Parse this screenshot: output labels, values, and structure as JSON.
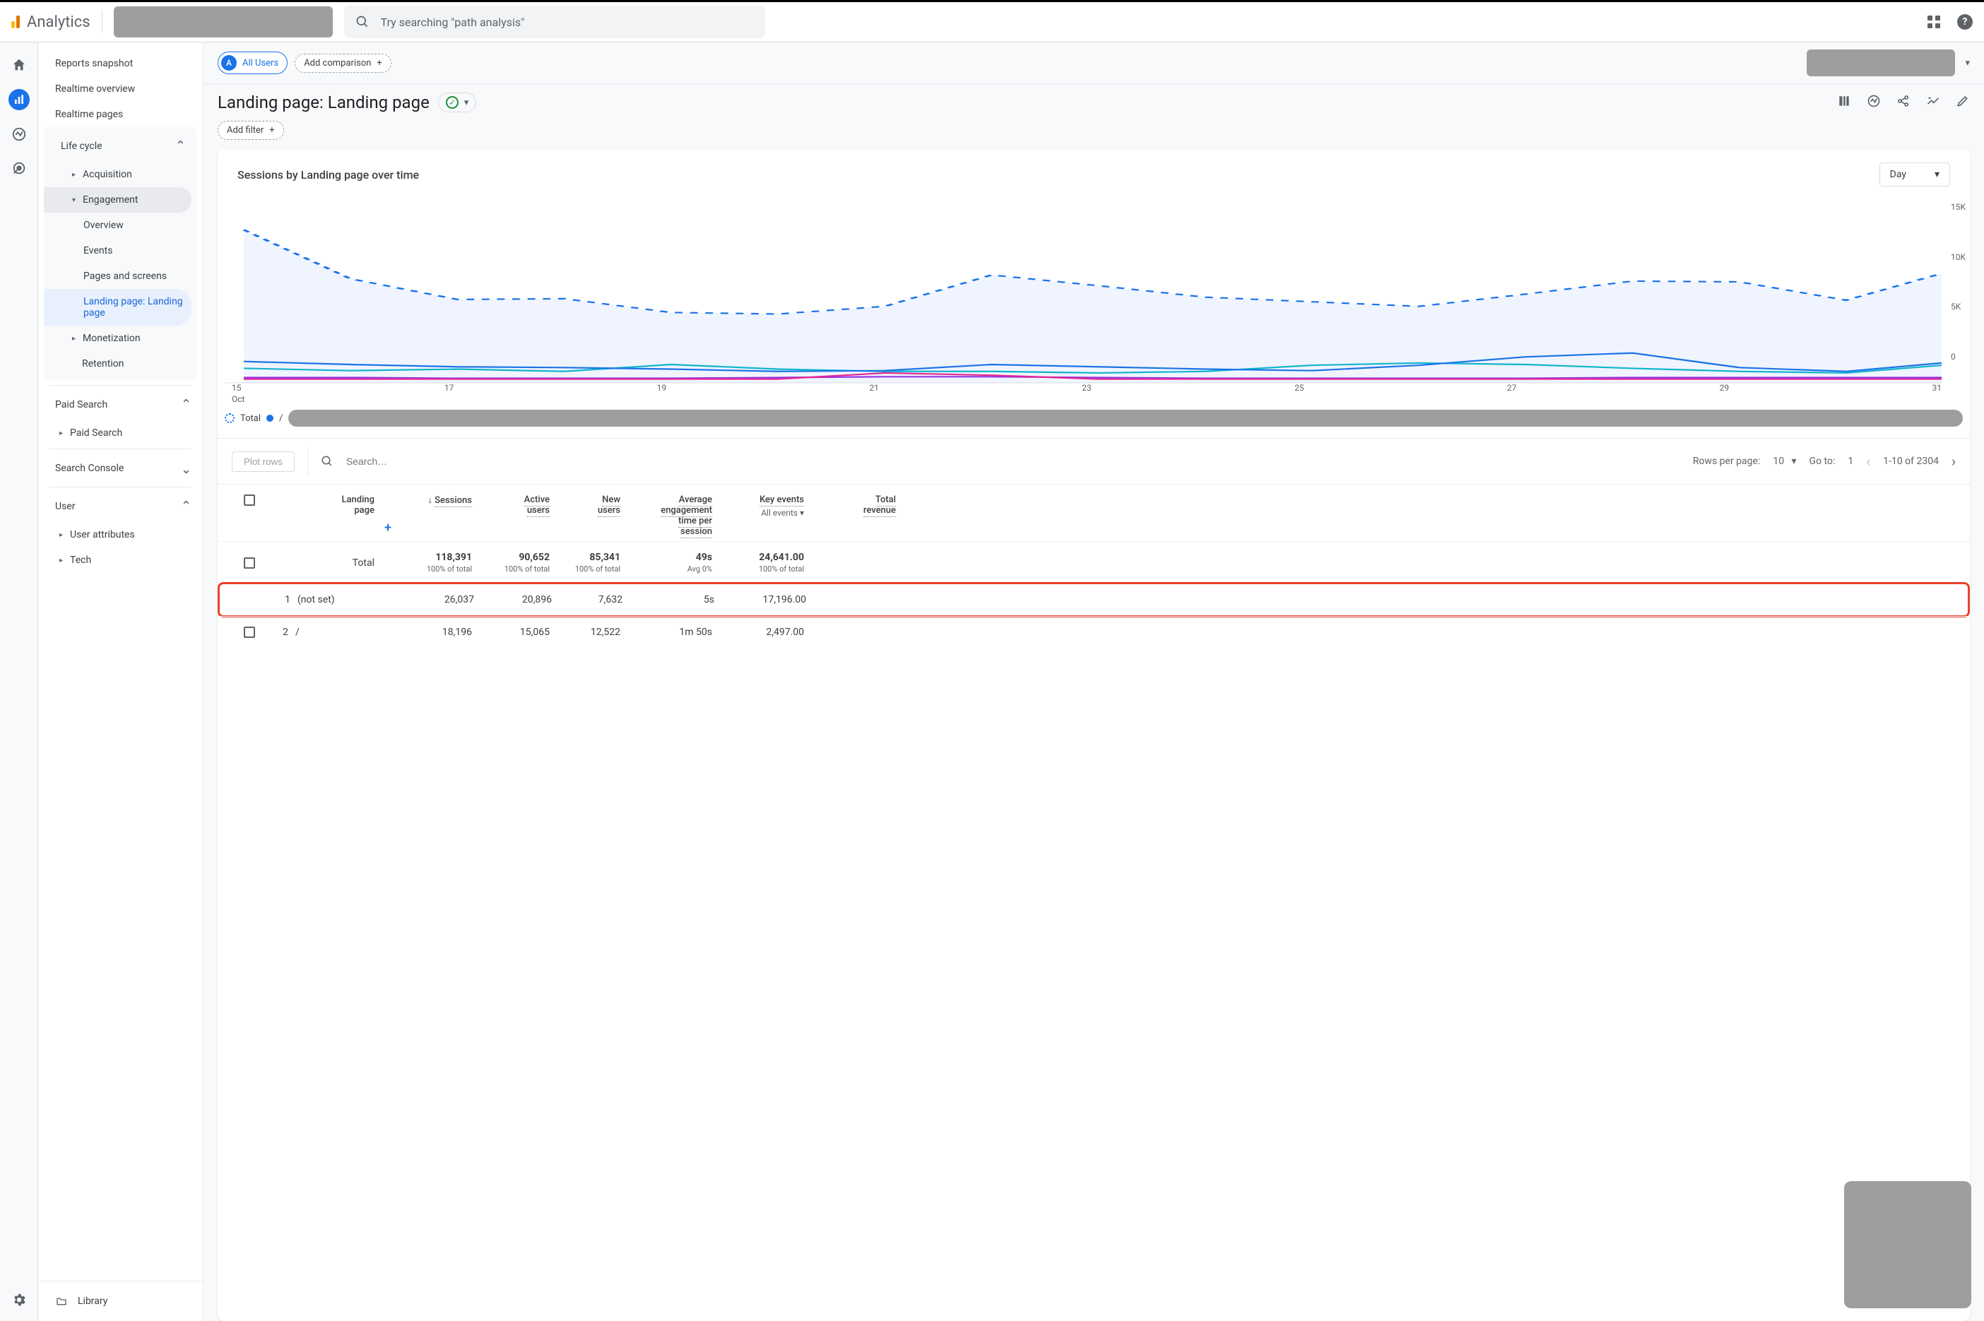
{
  "header": {
    "brand": "Analytics",
    "search_placeholder": "Try searching \"path analysis\""
  },
  "sidebar": {
    "reports_snapshot": "Reports snapshot",
    "realtime_overview": "Realtime overview",
    "realtime_pages": "Realtime pages",
    "life_cycle": "Life cycle",
    "acquisition": "Acquisition",
    "engagement": "Engagement",
    "engagement_items": {
      "overview": "Overview",
      "events": "Events",
      "pages_screens": "Pages and screens",
      "landing": "Landing page: Landing page"
    },
    "monetization": "Monetization",
    "retention": "Retention",
    "paid_search": "Paid Search",
    "paid_search_item": "Paid Search",
    "search_console": "Search Console",
    "user": "User",
    "user_attributes": "User attributes",
    "tech": "Tech",
    "library": "Library"
  },
  "comparison": {
    "all_users": "All Users",
    "add_comparison": "Add comparison"
  },
  "page": {
    "title": "Landing page: Landing page",
    "add_filter": "Add filter"
  },
  "chart": {
    "title": "Sessions by Landing page over time",
    "selector": "Day",
    "y_labels": [
      "15K",
      "10K",
      "5K",
      "0"
    ],
    "x_labels": [
      "15",
      "17",
      "19",
      "21",
      "23",
      "25",
      "27",
      "29",
      "31"
    ],
    "x_month": "Oct",
    "legend_total": "Total",
    "legend_slash": "/"
  },
  "chart_data": {
    "type": "line",
    "xlabel": "Date (Oct)",
    "ylabel": "Sessions",
    "ylim": [
      0,
      15000
    ],
    "x": [
      15,
      16,
      17,
      18,
      19,
      20,
      21,
      22,
      23,
      24,
      25,
      26,
      27,
      28,
      29,
      30,
      31
    ],
    "series": [
      {
        "name": "Total",
        "style": "dashed",
        "color": "#1a73e8",
        "values": [
          12500,
          8500,
          6800,
          6900,
          5700,
          5600,
          6200,
          8800,
          7900,
          7000,
          6600,
          6200,
          7200,
          8300,
          8200,
          6700,
          8900
        ]
      },
      {
        "name": "/",
        "style": "solid",
        "color": "#1a73e8",
        "values": [
          1700,
          1500,
          1300,
          1200,
          1100,
          900,
          1000,
          1500,
          1300,
          1100,
          1000,
          1400,
          2100,
          2400,
          1200,
          900,
          1600
        ]
      },
      {
        "name": "series-teal",
        "style": "solid",
        "color": "#12b5cb",
        "values": [
          1200,
          1000,
          1100,
          900,
          1500,
          1100,
          900,
          900,
          800,
          900,
          1400,
          1600,
          1500,
          1200,
          900,
          800,
          1400
        ]
      },
      {
        "name": "series-purple",
        "style": "solid",
        "color": "#9334e6",
        "values": [
          400,
          400,
          300,
          300,
          300,
          400,
          500,
          500,
          400,
          300,
          300,
          300,
          300,
          400,
          400,
          400,
          400
        ]
      },
      {
        "name": "series-magenta",
        "style": "solid",
        "color": "#e52592",
        "values": [
          300,
          300,
          300,
          300,
          300,
          300,
          800,
          600,
          300,
          300,
          300,
          300,
          300,
          300,
          300,
          300,
          300
        ]
      }
    ]
  },
  "table_controls": {
    "plot_rows": "Plot rows",
    "search_placeholder": "Search…",
    "rows_per_page_label": "Rows per page:",
    "rows_per_page_value": "10",
    "goto_label": "Go to:",
    "goto_value": "1",
    "range": "1-10 of 2304"
  },
  "table": {
    "headers": {
      "landing_page": "Landing page",
      "sessions": "Sessions",
      "active_users": "Active users",
      "new_users": "New users",
      "aet": "Average engagement time per session",
      "key_events": "Key events",
      "key_events_sub": "All events",
      "total_revenue": "Total revenue"
    },
    "totals": {
      "label": "Total",
      "sessions": "118,391",
      "sessions_sub": "100% of total",
      "active_users": "90,652",
      "active_users_sub": "100% of total",
      "new_users": "85,341",
      "new_users_sub": "100% of total",
      "aet": "49s",
      "aet_sub": "Avg 0%",
      "key_events": "24,641.00",
      "key_events_sub": "100% of total"
    },
    "rows": [
      {
        "idx": "1",
        "lp": "(not set)",
        "sessions": "26,037",
        "au": "20,896",
        "nu": "7,632",
        "aet": "5s",
        "ke": "17,196.00"
      },
      {
        "idx": "2",
        "lp": "/",
        "sessions": "18,196",
        "au": "15,065",
        "nu": "12,522",
        "aet": "1m 50s",
        "ke": "2,497.00"
      }
    ]
  }
}
